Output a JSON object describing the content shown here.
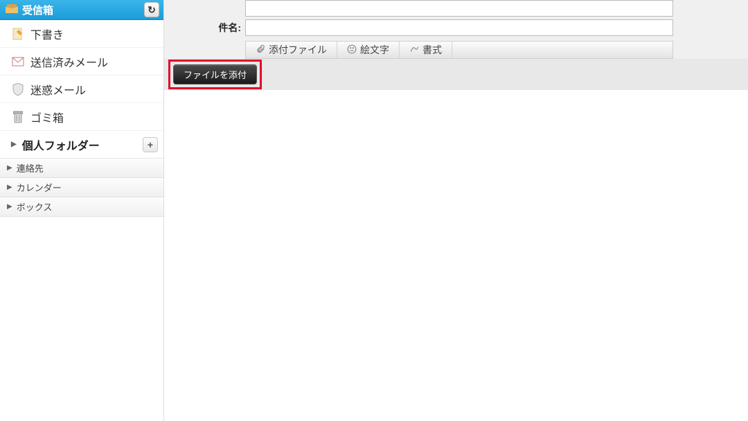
{
  "sidebar": {
    "header": {
      "title": "受信箱"
    },
    "items": [
      {
        "label": "下書き"
      },
      {
        "label": "送信済みメール"
      },
      {
        "label": "迷惑メール"
      },
      {
        "label": "ゴミ箱"
      }
    ],
    "personal_folder": {
      "label": "個人フォルダー"
    },
    "bottom": [
      {
        "label": "連絡先"
      },
      {
        "label": "カレンダー"
      },
      {
        "label": "ボックス"
      }
    ]
  },
  "compose": {
    "subject_label": "件名:",
    "tabs": {
      "attachment": "添付ファイル",
      "emoji": "絵文字",
      "format": "書式"
    },
    "attach_button": "ファイルを添付"
  }
}
